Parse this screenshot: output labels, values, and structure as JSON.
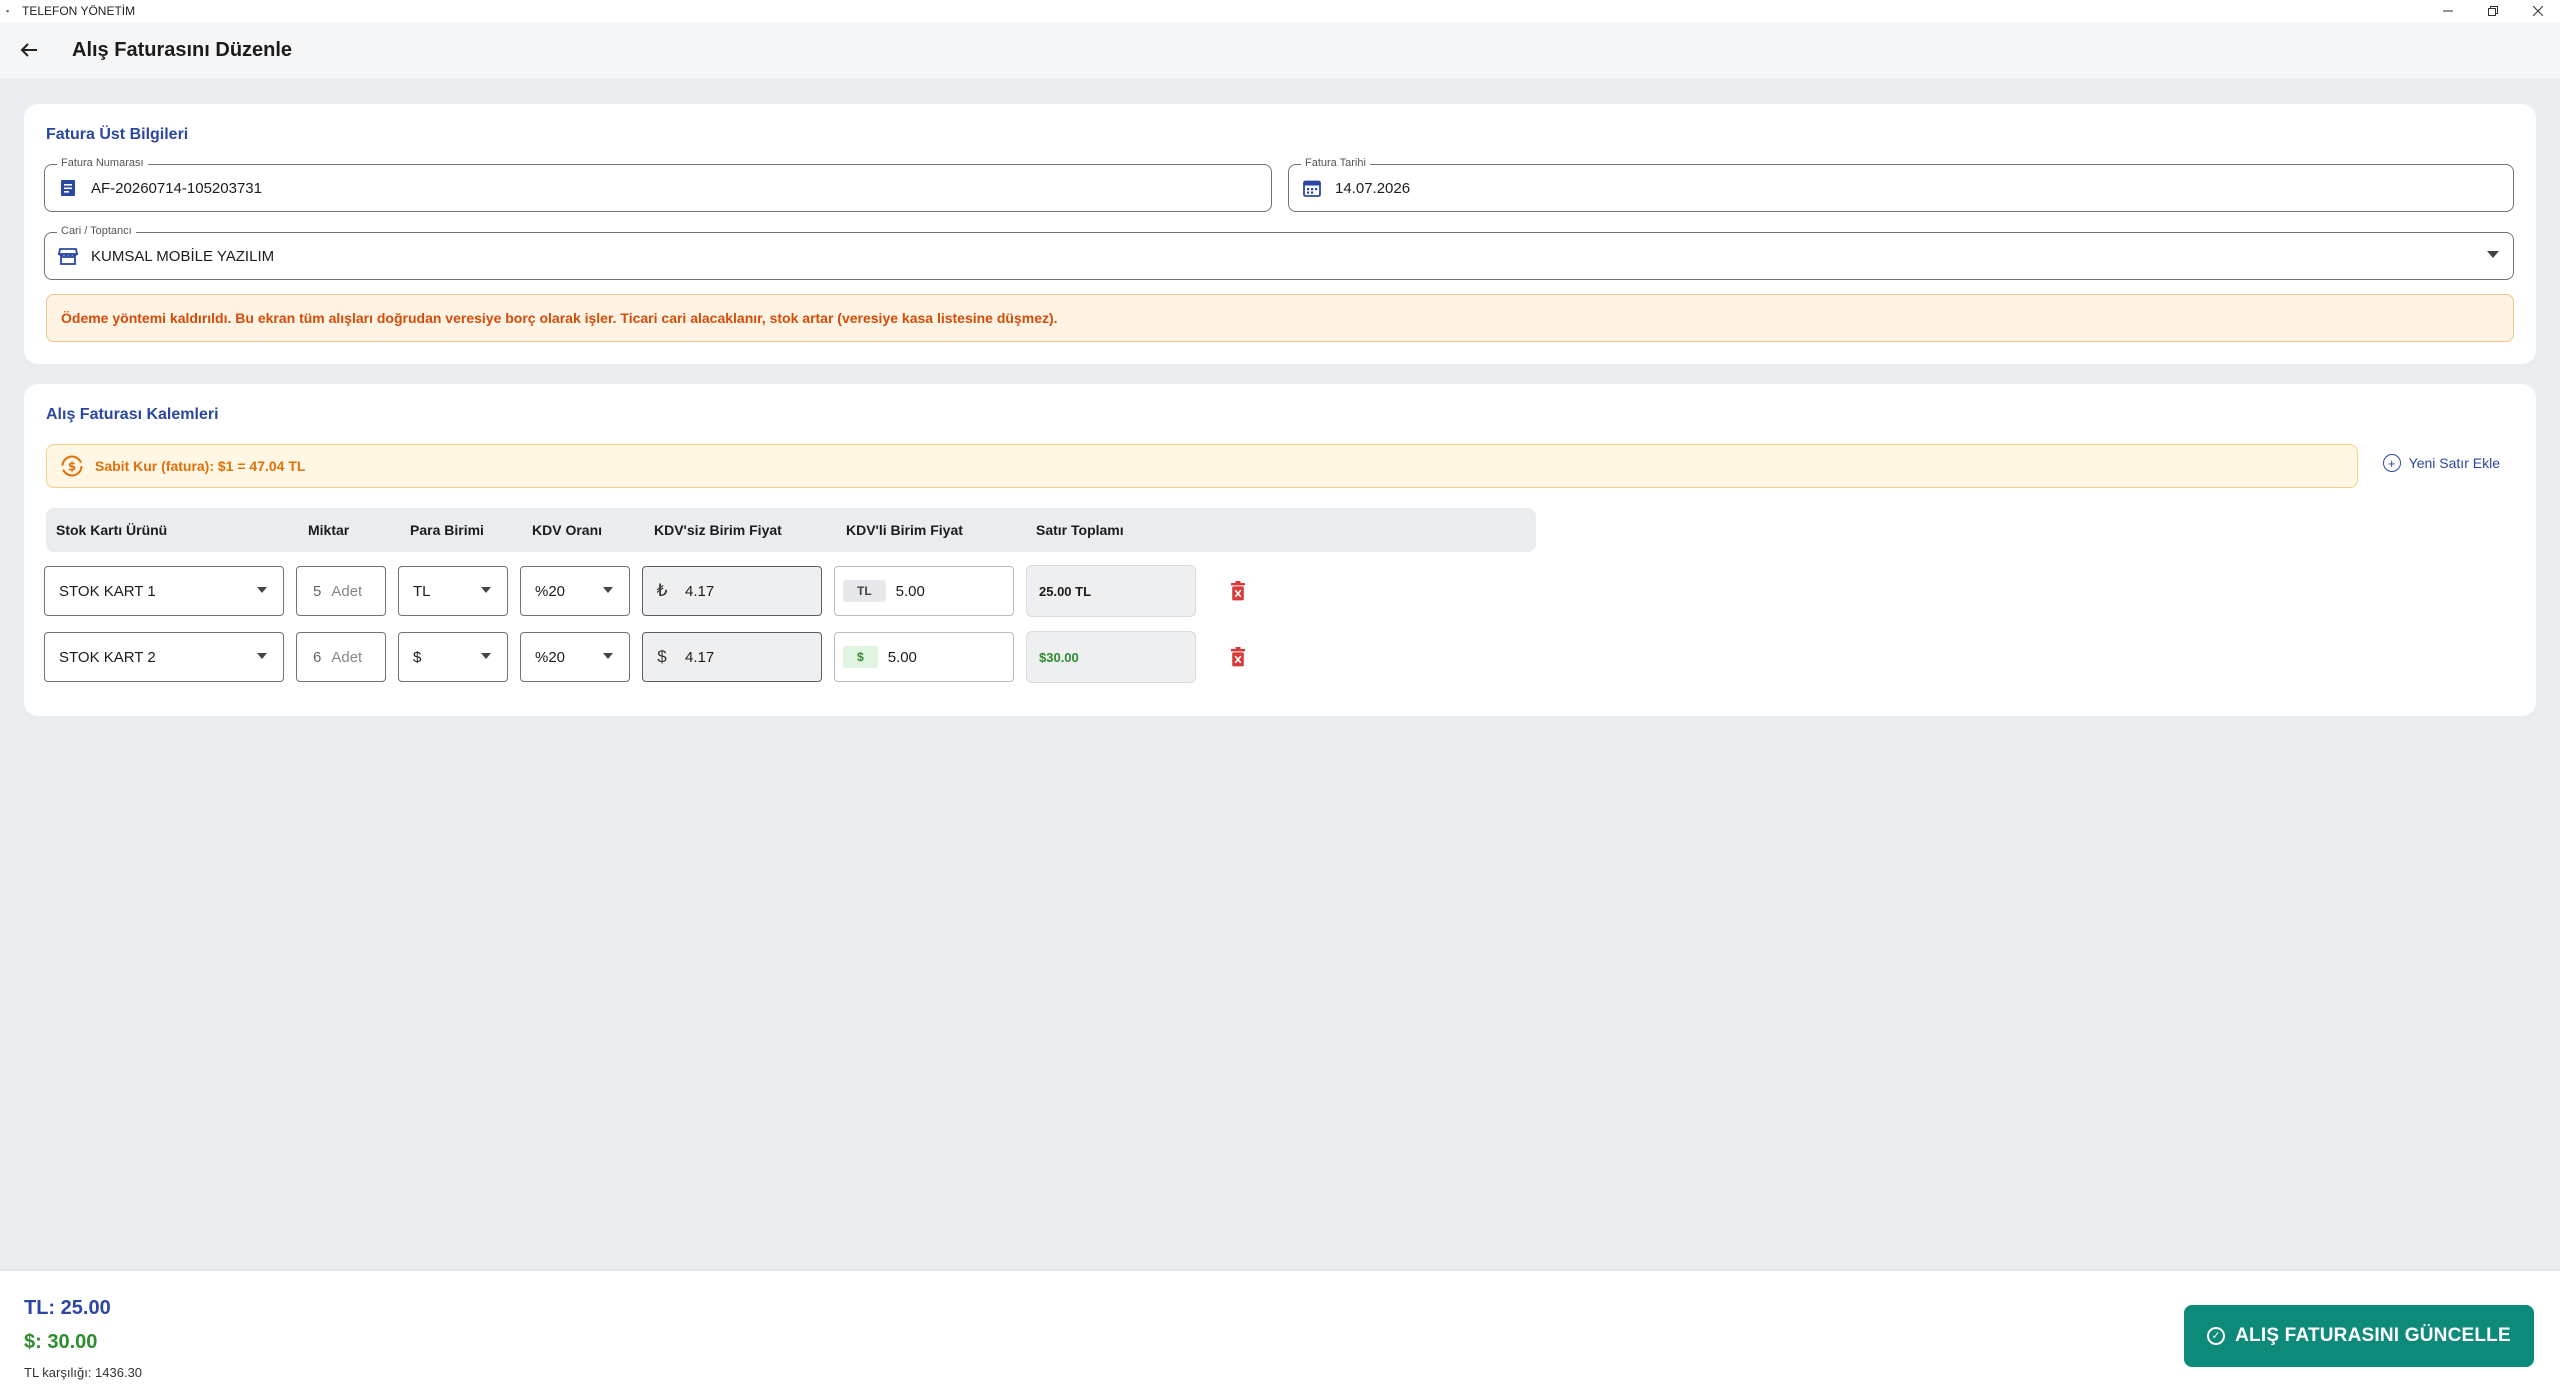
{
  "window": {
    "title": "TELEFON YÖNETİM"
  },
  "appbar": {
    "title": "Alış Faturasını Düzenle"
  },
  "header_section": {
    "title": "Fatura Üst Bilgileri",
    "invoice_number_label": "Fatura Numarası",
    "invoice_number": "AF-20260714-105203731",
    "invoice_date_label": "Fatura Tarihi",
    "invoice_date": "14.07.2026",
    "supplier_label": "Cari / Toptancı",
    "supplier": "KUMSAL MOBİLE YAZILIM",
    "warning": "Ödeme yöntemi kaldırıldı. Bu ekran tüm alışları doğrudan veresiye borç olarak işler. Ticari cari alacaklanır, stok artar (veresiye kasa listesine düşmez)."
  },
  "items_section": {
    "title": "Alış Faturası Kalemleri",
    "rate_banner": "Sabit Kur (fatura): $1 = 47.04 TL",
    "add_row_label": "Yeni Satır Ekle",
    "columns": [
      "Stok Kartı Ürünü",
      "Miktar",
      "Para Birimi",
      "KDV Oranı",
      "KDV'siz Birim Fiyat",
      "KDV'li Birim Fiyat",
      "Satır Toplamı"
    ],
    "rows": [
      {
        "product": "STOK KART 1",
        "qty": "5",
        "unit": "Adet",
        "currency": "TL",
        "vat": "%20",
        "price_symbol": "₺",
        "price_excl": "4.17",
        "incl_chip": "TL",
        "price_incl": "5.00",
        "total": "25.00 TL"
      },
      {
        "product": "STOK KART 2",
        "qty": "6",
        "unit": "Adet",
        "currency": "$",
        "vat": "%20",
        "price_symbol": "$",
        "price_excl": "4.17",
        "incl_chip": "$",
        "price_incl": "5.00",
        "total": "$30.00"
      }
    ]
  },
  "footer": {
    "total_tl": "TL: 25.00",
    "total_usd": "$: 30.00",
    "tl_equivalent": "TL karşılığı: 1436.30",
    "update_button": "ALIŞ FATURASINI GÜNCELLE"
  },
  "colors": {
    "primary": "#2b47a3",
    "accent_teal": "#0e8a7a",
    "usd_green": "#2f8c2f",
    "warning_text": "#d44c0a",
    "delete_red": "#d83a3a"
  }
}
